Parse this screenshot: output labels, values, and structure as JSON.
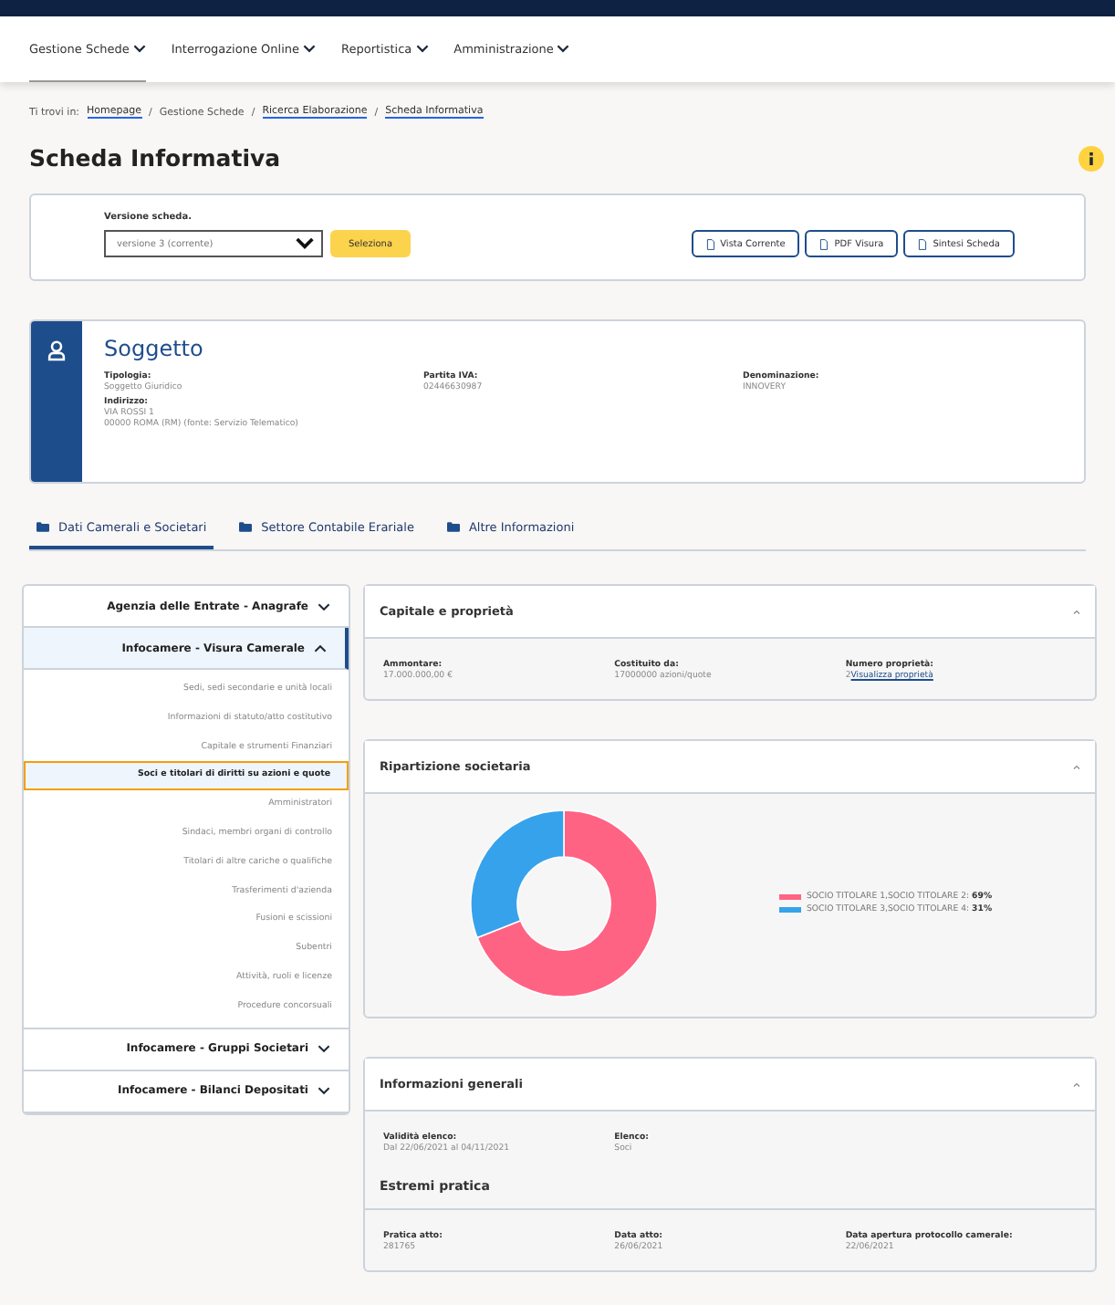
{
  "nav": [
    {
      "label": "Gestione Schede",
      "selected": true
    },
    {
      "label": "Interrogazione Online",
      "selected": false
    },
    {
      "label": "Reportistica",
      "selected": false
    },
    {
      "label": "Amministrazione",
      "selected": false
    }
  ],
  "breadcrumb": {
    "prefix": "Ti trovi in:",
    "separator": "/",
    "items": [
      {
        "label": "Homepage",
        "link": true
      },
      {
        "label": "Gestione Schede",
        "link": false
      },
      {
        "label": "Ricerca Elaborazione",
        "link": true
      },
      {
        "label": "Scheda Informativa",
        "link": true
      }
    ]
  },
  "page_title": "Scheda Informativa",
  "version": {
    "label": "Versione scheda.",
    "value": "versione 3 (corrente)",
    "select_button": "Seleziona",
    "actions": [
      "Vista Corrente",
      "PDF Visura",
      "Sintesi Scheda"
    ]
  },
  "soggetto": {
    "title": "Soggetto",
    "fields": [
      {
        "label": "Tipologia:",
        "values": [
          "Soggetto Giuridico"
        ]
      },
      {
        "label": "Partita IVA:",
        "values": [
          "02446630987"
        ]
      },
      {
        "label": "Denominazione:",
        "values": [
          "INNOVERY"
        ]
      },
      {
        "label": "Indirizzo:",
        "values": [
          "VIA ROSSI 1",
          "00000 ROMA (RM) (fonte: Servizio Telematico)"
        ]
      }
    ]
  },
  "tabs": [
    {
      "label": "Dati Camerali e Societari",
      "selected": true
    },
    {
      "label": "Settore Contabile Erariale",
      "selected": false
    },
    {
      "label": "Altre Informazioni",
      "selected": false
    }
  ],
  "sidebar": [
    {
      "label": "Agenzia delle Entrate - Anagrafe",
      "expanded": false
    },
    {
      "label": "Infocamere - Visura Camerale",
      "expanded": true,
      "children": [
        {
          "label": "Sedi, sedi secondarie e unità locali",
          "selected": false
        },
        {
          "label": "Informazioni di statuto/atto costitutivo",
          "selected": false
        },
        {
          "label": "Capitale e strumenti Finanziari",
          "selected": false
        },
        {
          "label": "Soci e titolari di diritti su azioni e quote",
          "selected": true
        },
        {
          "label": "Amministratori",
          "selected": false
        },
        {
          "label": "Sindaci, membri organi di controllo",
          "selected": false
        },
        {
          "label": "Titolari di altre cariche o qualifiche",
          "selected": false
        },
        {
          "label": "Trasferimenti d'azienda",
          "selected": false
        },
        {
          "label": "Fusioni e scissioni",
          "selected": false
        },
        {
          "label": "Subentri",
          "selected": false
        },
        {
          "label": "Attività, ruoli e licenze",
          "selected": false
        },
        {
          "label": "Procedure concorsuali",
          "selected": false
        }
      ]
    },
    {
      "label": "Infocamere - Gruppi Societari",
      "expanded": false
    },
    {
      "label": "Infocamere - Bilanci Depositati",
      "expanded": false
    }
  ],
  "panels": [
    {
      "title": "Capitale e proprietà",
      "expanded": true,
      "blocks": [
        {
          "kind": "fields",
          "fields": [
            {
              "label": "Ammontare:",
              "value": "17.000.000,00 €"
            },
            {
              "label": "Costituito da:",
              "value": "17000000 azioni/quote"
            },
            {
              "label": "Numero proprietà:",
              "value": "2",
              "link": "Visualizza proprietà"
            }
          ]
        }
      ]
    },
    {
      "title": "Ripartizione societaria",
      "expanded": true,
      "blocks": [
        {
          "kind": "chart",
          "legend_separator": ":",
          "chart_data": {
            "type": "donut",
            "categories": [
              "SOCIO TITOLARE 1,SOCIO TITOLARE 2",
              "SOCIO TITOLARE 3,SOCIO TITOLARE 4"
            ],
            "series": [
              {
                "values": [
                  69,
                  31
                ]
              }
            ],
            "colors": [
              "#ff6384",
              "#36a2eb"
            ],
            "value_labels": [
              "69%",
              "31%"
            ]
          }
        }
      ]
    },
    {
      "title": "Informazioni generali",
      "expanded": true,
      "blocks": [
        {
          "kind": "fields",
          "fields": [
            {
              "label": "Validità elenco:",
              "value": "Dal 22/06/2021 al 04/11/2021"
            },
            {
              "label": "Elenco:",
              "value": "Soci"
            }
          ]
        },
        {
          "kind": "heading",
          "text": "Estremi pratica"
        },
        {
          "kind": "fields",
          "fields": [
            {
              "label": "Pratica atto:",
              "value": "281765"
            },
            {
              "label": "Data atto:",
              "value": "26/06/2021"
            },
            {
              "label": "Data apertura protocollo camerale:",
              "value": "22/06/2021"
            }
          ]
        }
      ]
    }
  ]
}
